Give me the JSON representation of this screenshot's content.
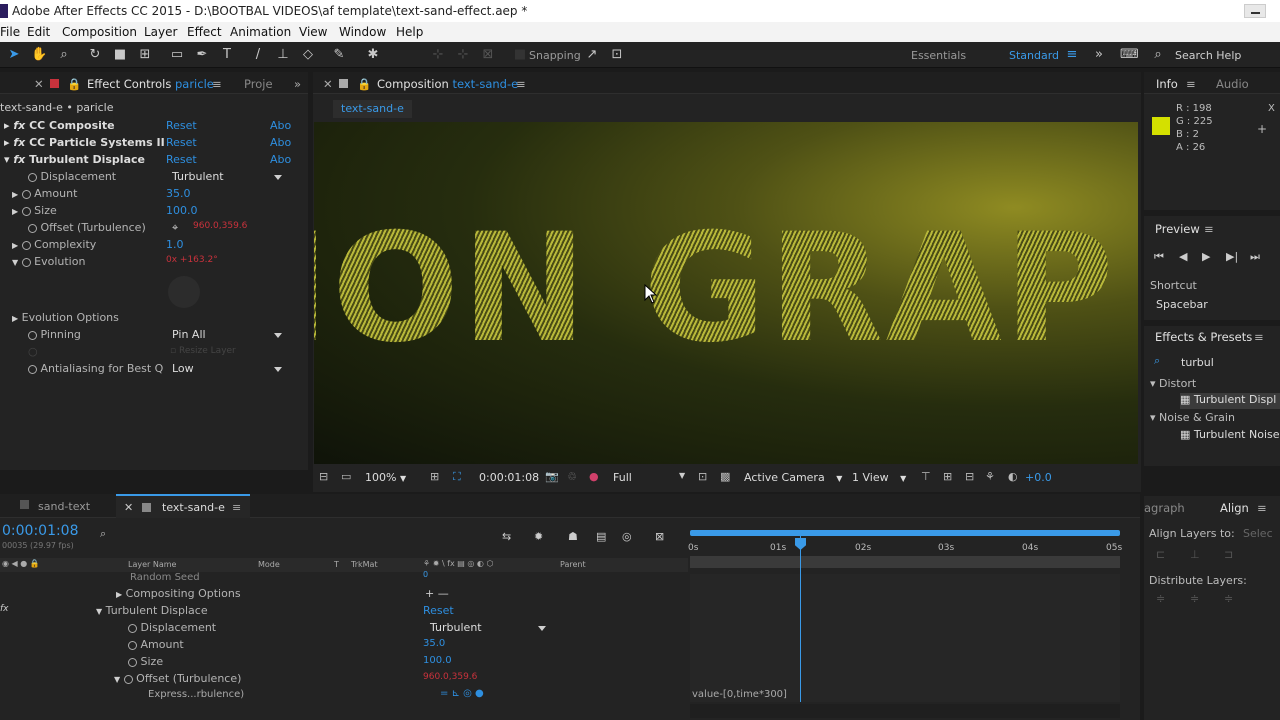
{
  "window": {
    "title": "Adobe After Effects CC 2015 - D:\\BOOTBAL VIDEOS\\af template\\text-sand-effect.aep *"
  },
  "menu": [
    "File",
    "Edit",
    "Composition",
    "Layer",
    "Effect",
    "Animation",
    "View",
    "Window",
    "Help"
  ],
  "toolbar": {
    "snapping": "Snapping",
    "workspace_essentials": "Essentials",
    "workspace_standard": "Standard",
    "search_help": "Search Help"
  },
  "effect_controls": {
    "tab_label": "Effect Controls",
    "tab_layer": "paricle",
    "tab_project": "Proje",
    "layer_path": "text-sand-e • paricle",
    "reset": "Reset",
    "about": "Abo",
    "effects": [
      "CC Composite",
      "CC Particle Systems II",
      "Turbulent Displace"
    ],
    "properties": [
      {
        "label": "Displacement",
        "value": "Turbulent",
        "kind": "dropdown"
      },
      {
        "label": "Amount",
        "value": "35.0",
        "kind": "number"
      },
      {
        "label": "Size",
        "value": "100.0",
        "kind": "number"
      },
      {
        "label": "Offset (Turbulence)",
        "value": "960.0,359.6",
        "kind": "point"
      },
      {
        "label": "Complexity",
        "value": "1.0",
        "kind": "number"
      },
      {
        "label": "Evolution",
        "value": "0x +163.2°",
        "kind": "expr"
      }
    ],
    "evolution_options": "Evolution Options",
    "pinning_label": "Pinning",
    "pinning_value": "Pin All",
    "resize_layer": "Resize Layer",
    "antialias_label": "Antialiasing for Best Q",
    "antialias_value": "Low"
  },
  "composition": {
    "tab_label": "Composition",
    "tab_name": "text-sand-e",
    "subtab": "text-sand-e",
    "preview_text": "ION GRAP",
    "zoom": "100%",
    "timecode": "0:00:01:08",
    "resolution": "Full",
    "camera": "Active Camera",
    "views": "1 View",
    "exposure": "+0.0"
  },
  "info": {
    "tab_info": "Info",
    "tab_audio": "Audio",
    "r": "R : 198",
    "g": "G : 225",
    "b": "B : 2",
    "a": "A : 26",
    "swatch_color": "#d4e000",
    "coord_x": "X",
    "coord_plus": "+"
  },
  "preview": {
    "title": "Preview",
    "shortcut_label": "Shortcut",
    "shortcut_value": "Spacebar"
  },
  "effects_presets": {
    "title": "Effects & Presets",
    "search_value": "turbul",
    "categories": [
      {
        "name": "Distort",
        "items": [
          "Turbulent Displ"
        ]
      },
      {
        "name": "Noise & Grain",
        "items": [
          "Turbulent Noise"
        ]
      }
    ]
  },
  "align": {
    "tab_paragraph": "agraph",
    "tab_align": "Align",
    "align_to_label": "Align Layers to:",
    "align_to_value": "Selec",
    "distribute_label": "Distribute Layers:"
  },
  "timeline": {
    "tab1": "sand-text",
    "tab2": "text-sand-e",
    "timecode": "0:00:01:08",
    "fps": "00035 (29.97 fps)",
    "col_layer_name": "Layer Name",
    "col_mode": "Mode",
    "col_t": "T",
    "col_trkmat": "TrkMat",
    "col_parent": "Parent",
    "ruler": [
      "0s",
      "01s",
      "02s",
      "03s",
      "04s",
      "05s"
    ],
    "rows": [
      {
        "label": "Random Seed",
        "value": "0"
      },
      {
        "label": "Compositing Options",
        "value": "+ —"
      },
      {
        "label": "Turbulent Displace",
        "value": "Reset"
      },
      {
        "label": "Displacement",
        "value": "Turbulent"
      },
      {
        "label": "Amount",
        "value": "35.0"
      },
      {
        "label": "Size",
        "value": "100.0"
      },
      {
        "label": "Offset (Turbulence)",
        "value": "960.0,359.6"
      },
      {
        "label": "Express...rbulence)",
        "value": ""
      }
    ],
    "expression": "value-[0,time*300]",
    "playhead_time": "01s"
  }
}
